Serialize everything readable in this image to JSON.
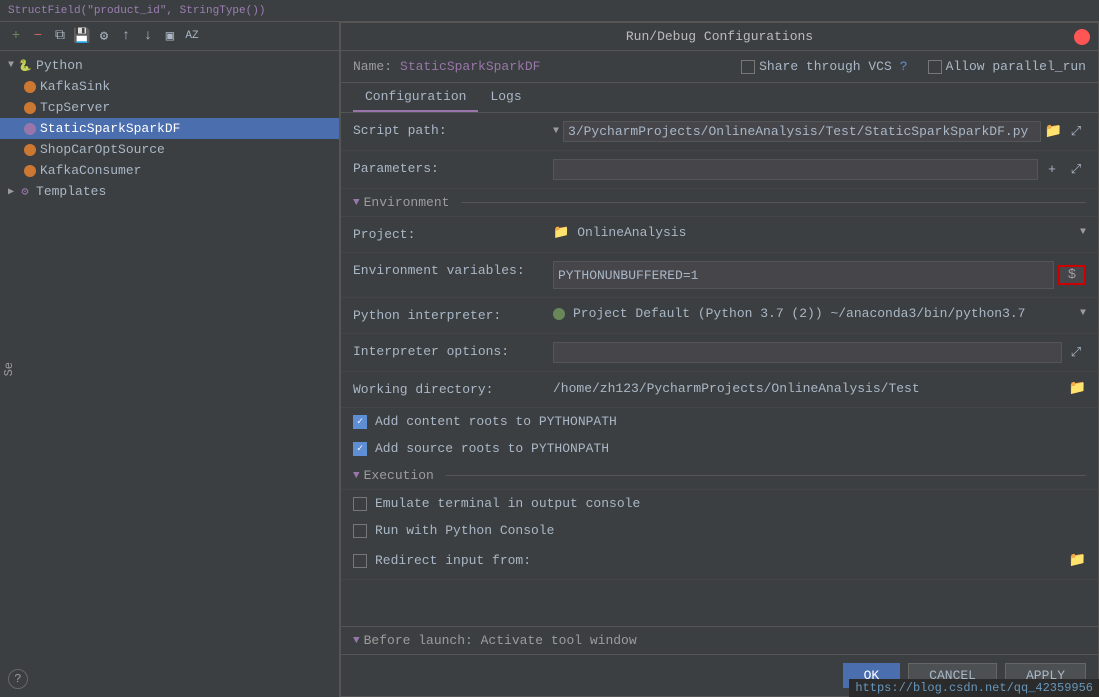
{
  "topbar": {
    "code": "StructField(\"product_id\", StringType())"
  },
  "dialog": {
    "title": "Run/Debug Configurations",
    "close_btn": "×",
    "name_label": "Name:",
    "name_value": "StaticSparkSparkDF",
    "share_label": "Share through VCS",
    "allow_parallel_label": "Allow parallel_run",
    "tabs": [
      "Configuration",
      "Logs"
    ],
    "active_tab": "Configuration",
    "script_path_label": "Script path:",
    "script_path_value": "3/PycharmProjects/OnlineAnalysis/Test/StaticSparkSparkDF.py",
    "parameters_label": "Parameters:",
    "environment_section": "Environment",
    "project_label": "Project:",
    "project_value": "OnlineAnalysis",
    "env_vars_label": "Environment variables:",
    "env_vars_value": "PYTHONUNBUFFERED=1",
    "python_interp_label": "Python interpreter:",
    "python_interp_value": "Project Default (Python 3.7 (2)) ~/anaconda3/bin/python3.7",
    "interp_options_label": "Interpreter options:",
    "working_dir_label": "Working directory:",
    "working_dir_value": "/home/zh123/PycharmProjects/OnlineAnalysis/Test",
    "add_content_roots": "Add content roots to PYTHONPATH",
    "add_source_roots": "Add source roots to PYTHONPATH",
    "execution_section": "Execution",
    "emulate_terminal": "Emulate terminal in output console",
    "run_python_console": "Run with Python Console",
    "redirect_input": "Redirect input from:",
    "before_launch": "Before launch: Activate tool window",
    "ok_btn": "OK",
    "cancel_btn": "CANCEL",
    "apply_btn": "APPLY",
    "dollar_sign": "$"
  },
  "sidebar": {
    "toolbar_icons": [
      "+",
      "−",
      "⧉",
      "💾",
      "⚙",
      "↑",
      "↓",
      "▣",
      "AZ"
    ],
    "python_label": "Python",
    "items": [
      {
        "name": "KafkaSink",
        "icon": "kafka"
      },
      {
        "name": "TcpServer",
        "icon": "tcp"
      },
      {
        "name": "StaticSparkSparkDF",
        "icon": "static",
        "selected": true
      },
      {
        "name": "ShopCarOptSource",
        "icon": "shop"
      },
      {
        "name": "KafkaConsumer",
        "icon": "consumer"
      }
    ],
    "templates_label": "Templates"
  },
  "side_label": "Se",
  "question_mark": "?",
  "watermark": "https://blog.csdn.net/qq_42359956"
}
